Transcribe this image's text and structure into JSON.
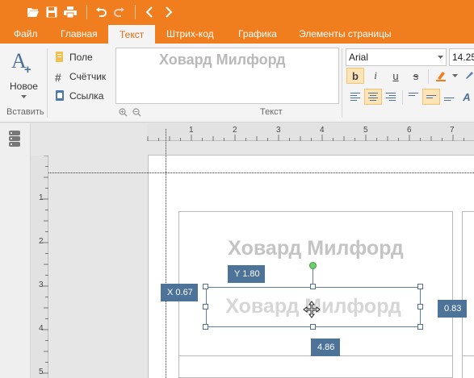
{
  "quick_access": {
    "icons": [
      "folder-open-icon",
      "save-icon",
      "print-icon",
      "undo-icon",
      "redo-icon",
      "back-icon",
      "forward-icon"
    ]
  },
  "tabs": [
    {
      "label": "Файл",
      "active": false
    },
    {
      "label": "Главная",
      "active": false
    },
    {
      "label": "Текст",
      "active": true
    },
    {
      "label": "Штрих-код",
      "active": false
    },
    {
      "label": "Графика",
      "active": false
    },
    {
      "label": "Элементы страницы",
      "active": false
    }
  ],
  "ribbon": {
    "insert_group": {
      "new_label": "Новое",
      "group_label": "Вставить",
      "field_label": "Поле",
      "counter_label": "Счётчик",
      "link_label": "Ссылка"
    },
    "text_group": {
      "preview_text": "Ховард Милфорд",
      "group_label": "Текст"
    },
    "font": {
      "family": "Arial",
      "size": "14.25"
    }
  },
  "rulers": {
    "horizontal": [
      "1",
      "2",
      "3",
      "4",
      "5",
      "6",
      "7"
    ],
    "vertical": [
      "1",
      "2",
      "3",
      "4",
      "5"
    ]
  },
  "canvas": {
    "static_text": "Ховард Милфорд",
    "selected_text": "Ховард Милфорд",
    "badge_y": "Y 1.80",
    "badge_x": "X 0.67",
    "badge_right": "0.83",
    "badge_width": "4.86"
  },
  "colors": {
    "accent": "#f07d1e",
    "badge": "#4d7399",
    "selection": "#5b7fa6"
  }
}
